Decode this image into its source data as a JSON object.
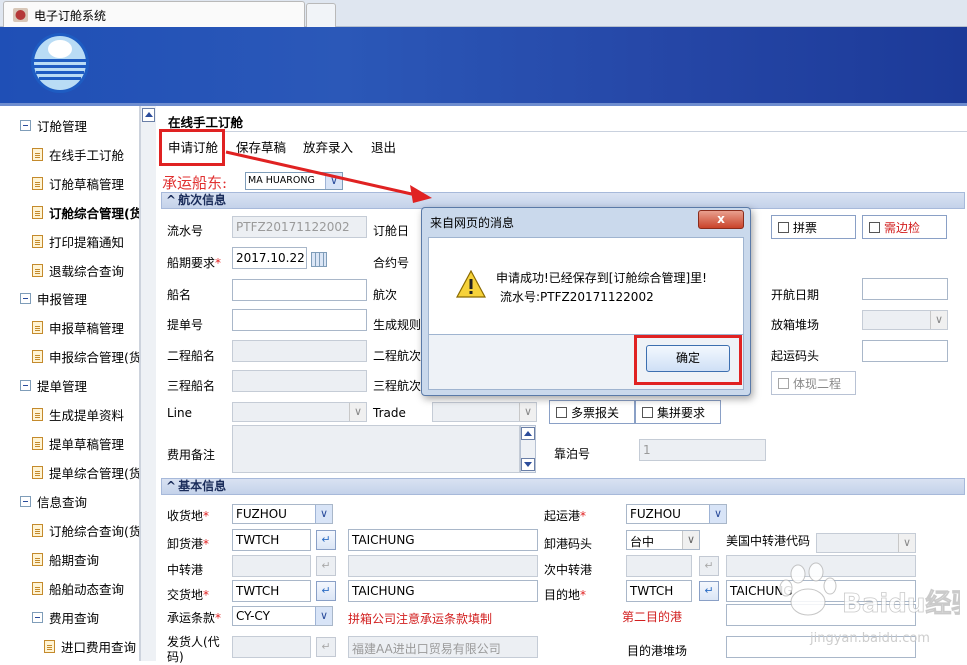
{
  "window": {
    "tab_title": "电子订舱系统"
  },
  "sidebar": {
    "groups": [
      {
        "label": "订舱管理",
        "items": [
          "在线手工订舱",
          "订舱草稿管理",
          "订舱综合管理(货",
          "打印提箱通知",
          "退载综合查询"
        ]
      },
      {
        "label": "申报管理",
        "items": [
          "申报草稿管理",
          "申报综合管理(货"
        ]
      },
      {
        "label": "提单管理",
        "items": [
          "生成提单资料",
          "提单草稿管理",
          "提单综合管理(货"
        ]
      },
      {
        "label": "信息查询",
        "items": [
          "订舱综合查询(货",
          "船期查询",
          "船舶动态查询"
        ]
      },
      {
        "label": "费用查询",
        "items": [
          "进口费用查询"
        ]
      }
    ]
  },
  "page": {
    "title": "在线手工订舱"
  },
  "toolbar": {
    "apply": "申请订舱",
    "save_draft": "保存草稿",
    "discard": "放弃录入",
    "exit": "退出"
  },
  "carrier": {
    "label": "承运船东:",
    "value": "MA   HUARONG"
  },
  "voyage_section": {
    "title": "航次信息",
    "serial_label": "流水号",
    "serial_value": "PTFZ20171122002",
    "booking_date_label": "订舱日",
    "sailing_req_label": "船期要求",
    "sailing_req_value": "2017.10.22",
    "contract_label": "合约号",
    "vessel_label": "船名",
    "voyage_label": "航次",
    "bl_label": "提单号",
    "gen_rule_label": "生成规则",
    "second_vessel_label": "二程船名",
    "second_voyage_label": "二程航次",
    "third_vessel_label": "三程船名",
    "third_voyage_label": "三程航次",
    "line_label": "Line",
    "trade_label": "Trade",
    "fee_note_label": "费用备注",
    "lcl_label": "拼票",
    "need_side_label": "需边检",
    "start_date_label": "开航日期",
    "yard_label": "放箱堆场",
    "origin_wharf_label": "起运码头",
    "show_second_label": "体现二程",
    "multi_declare_label": "多票报关",
    "consolidate_label": "集拼要求",
    "berth_label": "靠泊号",
    "berth_value": "1"
  },
  "basic_section": {
    "title": "基本信息",
    "receipt_label": "收货地",
    "receipt_value": "FUZHOU",
    "pol_label": "起运港",
    "pol_value": "FUZHOU",
    "pod_label": "卸货港",
    "pod_code": "TWTCH",
    "pod_name": "TAICHUNG",
    "pod_wharf_label": "卸港码头",
    "pod_wharf_value": "台中",
    "us_transit_label": "美国中转港代码",
    "transit_label": "中转港",
    "next_transit_label": "次中转港",
    "delivery_label": "交货地",
    "delivery_code": "TWTCH",
    "delivery_name": "TAICHUNG",
    "dest_label": "目的地",
    "dest_code": "TWTCH",
    "dest_name": "TAICHUNG",
    "terms_label": "承运条款",
    "terms_value": "CY-CY",
    "terms_note": "拼箱公司注意承运条款填制",
    "second_dest_label": "第二目的港",
    "shipper_label": "发货人(代码)",
    "shipper_value": "福建AA进出口贸易有限公司",
    "dest_yard_label": "目的港堆场"
  },
  "dialog": {
    "title": "来自网页的消息",
    "close": "x",
    "message_line1": "申请成功!已经保存到[订舱综合管理]里!",
    "message_line2": "流水号:PTFZ20171122002",
    "ok": "确定"
  },
  "watermark": {
    "text": "Baidu经验",
    "sub": "jingyan.baidu.com"
  },
  "colors": {
    "banner": "#2b58b8",
    "highlight": "#e02222",
    "required": "#e02222"
  }
}
